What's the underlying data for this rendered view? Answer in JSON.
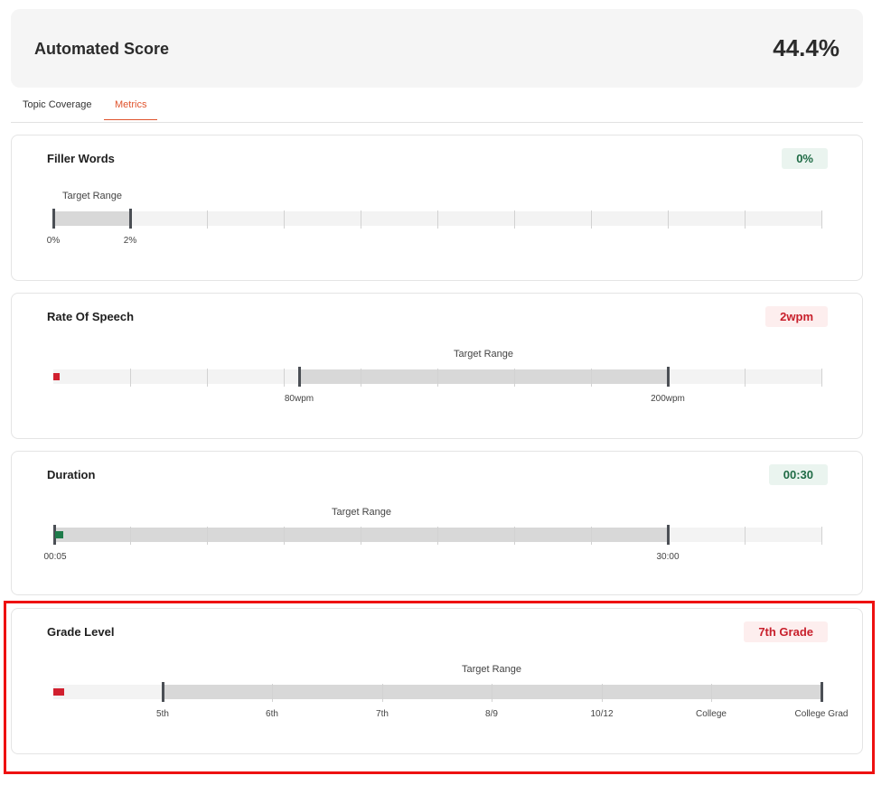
{
  "score": {
    "title": "Automated Score",
    "value": "44.4%"
  },
  "tabs": [
    {
      "label": "Topic Coverage",
      "active": false
    },
    {
      "label": "Metrics",
      "active": true
    }
  ],
  "metrics": {
    "filler_words": {
      "title": "Filler Words",
      "badge": "0%",
      "badge_status": "good",
      "range_caption": "Target Range",
      "labels": {
        "a": "0%",
        "b": "2%"
      },
      "current_value_percent": 0
    },
    "rate_of_speech": {
      "title": "Rate Of Speech",
      "badge": "2wpm",
      "badge_status": "bad",
      "range_caption": "Target Range",
      "labels": {
        "a": "80wpm",
        "b": "200wpm"
      },
      "current_value_wpm": 2
    },
    "duration": {
      "title": "Duration",
      "badge": "00:30",
      "badge_status": "good",
      "range_caption": "Target Range",
      "labels": {
        "a": "00:05",
        "b": "30:00"
      },
      "current_value": "00:30"
    },
    "grade_level": {
      "title": "Grade Level",
      "badge": "7th Grade",
      "badge_status": "bad",
      "range_caption": "Target Range",
      "labels": [
        "5th",
        "6th",
        "7th",
        "8/9",
        "10/12",
        "College",
        "College Grad"
      ],
      "current_value": "7th Grade"
    }
  },
  "colors": {
    "accent": "#e0542d",
    "good": "#1e7b4a",
    "bad": "#d1202f",
    "highlight": "#ee1111"
  }
}
